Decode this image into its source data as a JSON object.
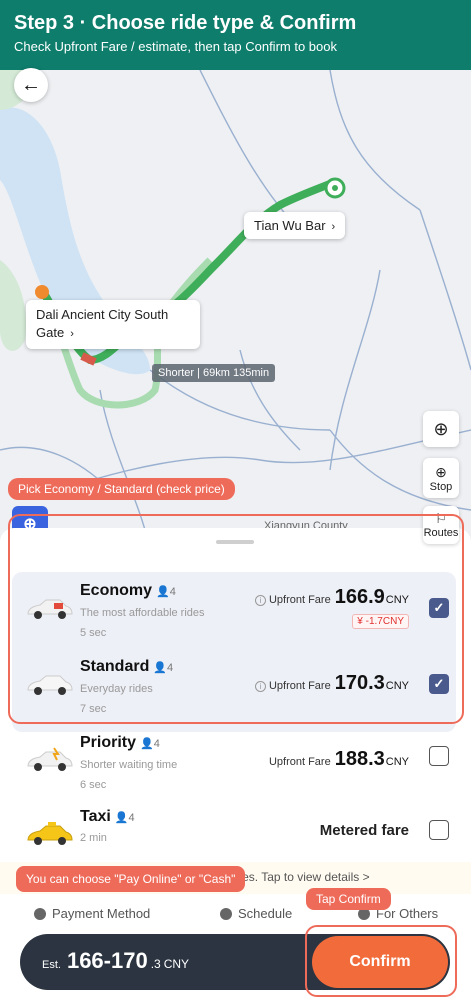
{
  "header": {
    "title": "Step 3 · Choose ride type & Confirm",
    "subtitle": "Check Upfront Fare / estimate, then tap Confirm to book"
  },
  "map": {
    "destination": "Tian Wu Bar",
    "origin": "Dali Ancient City South Gate",
    "route_label": "Shorter | 69km 135min",
    "county": "Xiangyun County",
    "stop_label": "Stop",
    "routes_label": "Routes"
  },
  "annotations": {
    "pick": "Pick Economy / Standard (check price)",
    "pay": "You can choose \"Pay Online\" or \"Cash\"",
    "confirm": "Tap Confirm"
  },
  "rides": [
    {
      "name": "Economy",
      "pax": "4",
      "desc": "The most affordable rides",
      "time": "5 sec",
      "fare_label": "Upfront Fare",
      "fare": "166.9",
      "currency": "CNY",
      "discount": "-1.7CNY",
      "selected": true
    },
    {
      "name": "Standard",
      "pax": "4",
      "desc": "Everyday rides",
      "time": "7 sec",
      "fare_label": "Upfront Fare",
      "fare": "170.3",
      "currency": "CNY",
      "selected": true
    },
    {
      "name": "Priority",
      "pax": "4",
      "desc": "Shorter waiting time",
      "time": "6 sec",
      "fare_label": "Upfront Fare",
      "fare": "188.3",
      "currency": "CNY",
      "selected": false
    },
    {
      "name": "Taxi",
      "pax": "4",
      "time": "2 min",
      "fare_text": "Metered fare",
      "selected": false
    }
  ],
  "special_notice": "This trip has multiple special fares. Tap to view details >",
  "options": {
    "payment": "Payment Method",
    "schedule": "Schedule",
    "for_others": "For Others"
  },
  "bottom": {
    "est_label": "Est.",
    "est_value": "166-170",
    "est_decimal": ".3",
    "est_currency": "CNY",
    "confirm": "Confirm"
  },
  "colors": {
    "header": "#0e7d6c",
    "route": "#3fae5a",
    "confirm": "#f26b3a",
    "annotation": "#ee6b5a",
    "checkbox": "#4a5a8c"
  }
}
